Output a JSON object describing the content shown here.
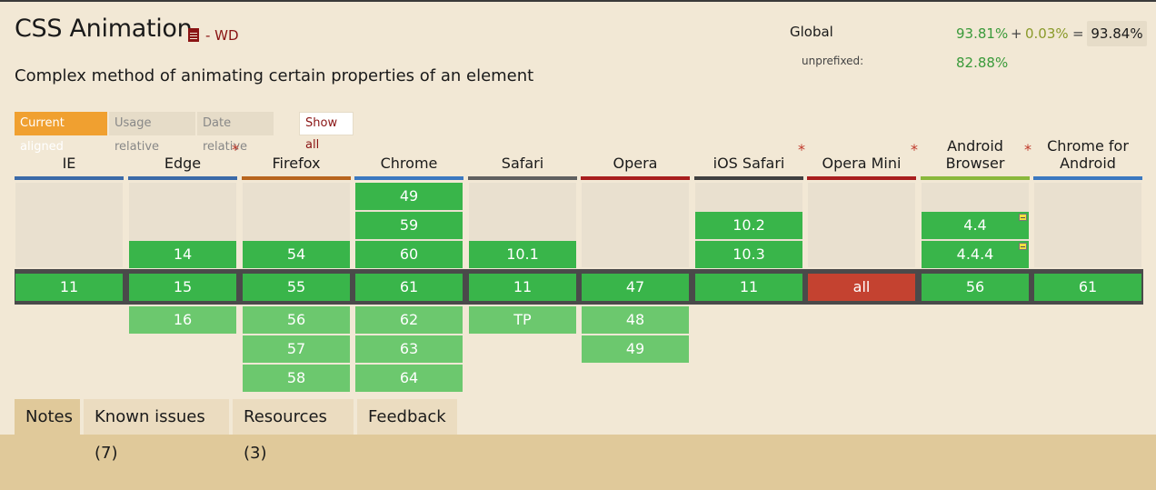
{
  "feature": {
    "title": "CSS Animation",
    "status": "- WD",
    "description": "Complex method of animating certain properties of an element"
  },
  "usage": {
    "global_label": "Global",
    "unprefixed_label": "unprefixed:",
    "supported": "93.81%",
    "plus": "+",
    "partial": "0.03%",
    "equals": "=",
    "total": "93.84%",
    "unprefixed": "82.88%"
  },
  "view_modes": {
    "current": "Current aligned",
    "usage": "Usage relative",
    "date": "Date relative",
    "show_all": "Show all"
  },
  "colors": {
    "supported": "#39b54a",
    "supported_future": "#6cc86e",
    "unsupported": "#c44230",
    "accent": "#f0a030",
    "partial_flag": "#f0e040"
  },
  "browsers": [
    {
      "name": "IE",
      "star": "",
      "bar_color": "#3b6aa8",
      "past": [],
      "current": "11",
      "future": []
    },
    {
      "name": "Edge",
      "star": "*",
      "bar_color": "#3b6aa8",
      "past": [
        "",
        "",
        "14"
      ],
      "current": "15",
      "future": [
        "16"
      ]
    },
    {
      "name": "Firefox",
      "star": "",
      "bar_color": "#b8651e",
      "past": [
        "",
        "",
        "54"
      ],
      "current": "55",
      "future": [
        "56",
        "57",
        "58"
      ]
    },
    {
      "name": "Chrome",
      "star": "",
      "bar_color": "#3b78c0",
      "past": [
        "49",
        "59",
        "60"
      ],
      "current": "61",
      "future": [
        "62",
        "63",
        "64"
      ]
    },
    {
      "name": "Safari",
      "star": "",
      "bar_color": "#606060",
      "past": [
        "",
        "",
        "10.1"
      ],
      "current": "11",
      "future": [
        "TP"
      ]
    },
    {
      "name": "Opera",
      "star": "",
      "bar_color": "#a81e1e",
      "past": [],
      "current": "47",
      "future": [
        "48",
        "49"
      ]
    },
    {
      "name": "iOS Safari",
      "star": "*",
      "bar_color": "#404040",
      "past": [
        "",
        "10.2",
        "10.3"
      ],
      "current": "11",
      "future": []
    },
    {
      "name": "Opera Mini",
      "star": "*",
      "bar_color": "#a81e1e",
      "past": [],
      "current": "all",
      "current_unsupported": true,
      "future": []
    },
    {
      "name": "Android Browser",
      "name_line1": "Android",
      "name_line2": "Browser",
      "star": "*",
      "bar_color": "#8ab83c",
      "past": [
        "",
        "4.4",
        "4.4.4"
      ],
      "past_flags": [
        false,
        true,
        true
      ],
      "current": "56",
      "future": []
    },
    {
      "name": "Chrome for Android",
      "name_line1": "Chrome for",
      "name_line2": "Android",
      "star": "",
      "bar_color": "#3b78c0",
      "past": [],
      "current": "61",
      "future": []
    }
  ],
  "info_tabs": [
    {
      "label": "Notes",
      "active": true
    },
    {
      "label": "Known issues (7)",
      "active": false
    },
    {
      "label": "Resources (3)",
      "active": false
    },
    {
      "label": "Feedback",
      "active": false
    }
  ]
}
